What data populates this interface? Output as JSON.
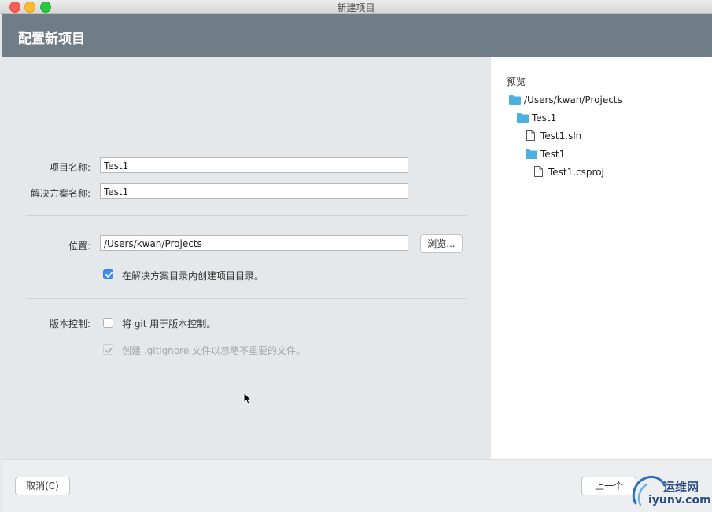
{
  "window": {
    "title": "新建项目"
  },
  "header": {
    "title": "配置新项目"
  },
  "form": {
    "project_name_label": "项目名称:",
    "project_name_value": "Test1",
    "solution_name_label": "解决方案名称:",
    "solution_name_value": "Test1",
    "location_label": "位置:",
    "location_value": "/Users/kwan/Projects",
    "browse_label": "浏览...",
    "create_dir_label": "在解决方案目录内创建项目目录。",
    "create_dir_checked": true,
    "vcs_label": "版本控制:",
    "use_git_label": "将 git 用于版本控制。",
    "use_git_checked": false,
    "gitignore_label": "创建 .gitignore 文件以忽略不重要的文件。",
    "gitignore_checked": true
  },
  "preview": {
    "title": "预览",
    "tree": [
      {
        "label": "/Users/kwan/Projects",
        "icon": "folder-icon"
      },
      {
        "label": "Test1",
        "icon": "folder-icon"
      },
      {
        "label": "Test1.sln",
        "icon": "file-icon"
      },
      {
        "label": "Test1",
        "icon": "folder-icon"
      },
      {
        "label": "Test1.csproj",
        "icon": "file-icon"
      }
    ]
  },
  "footer": {
    "cancel_label": "取消(C)",
    "back_label": "上一个"
  },
  "watermark": {
    "line1": "运维网",
    "line2": "iyunv.com"
  },
  "colors": {
    "header_bg": "#707c86",
    "accent": "#3d8ef0",
    "folder": "#4ab0e0"
  }
}
